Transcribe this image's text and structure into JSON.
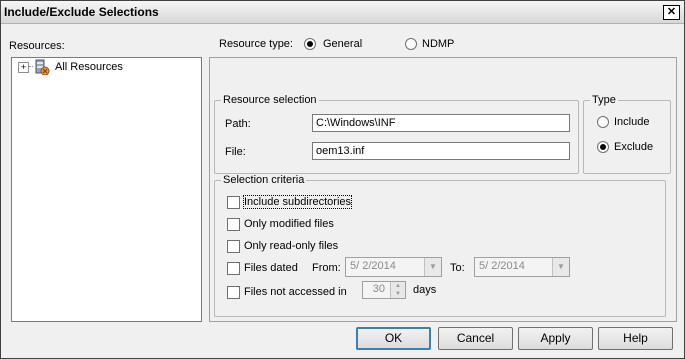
{
  "window": {
    "title": "Include/Exclude Selections",
    "close_glyph": "✕"
  },
  "resources": {
    "label": "Resources:",
    "tree": [
      {
        "expander": "+",
        "icon": "server-resources-icon",
        "label": "All Resources"
      }
    ]
  },
  "resource_type": {
    "label": "Resource type:",
    "options": [
      {
        "label": "General",
        "selected": true
      },
      {
        "label": "NDMP",
        "selected": false
      }
    ]
  },
  "resource_selection": {
    "legend": "Resource selection",
    "path_label": "Path:",
    "path_value": "C:\\Windows\\INF",
    "file_label": "File:",
    "file_value": "oem13.inf"
  },
  "type": {
    "legend": "Type",
    "options": [
      {
        "label": "Include",
        "selected": false
      },
      {
        "label": "Exclude",
        "selected": true
      }
    ]
  },
  "selection_criteria": {
    "legend": "Selection criteria",
    "include_subdirectories": "Include subdirectories",
    "only_modified": "Only modified files",
    "only_read_only": "Only read-only files",
    "files_dated": "Files dated",
    "from_label": "From:",
    "from_value": "5/  2/2014",
    "to_label": "To:",
    "to_value": "5/  2/2014",
    "not_accessed": "Files not accessed in",
    "days_value": "30",
    "days_label": "days"
  },
  "buttons": {
    "ok": "OK",
    "cancel": "Cancel",
    "apply": "Apply",
    "help": "Help"
  }
}
